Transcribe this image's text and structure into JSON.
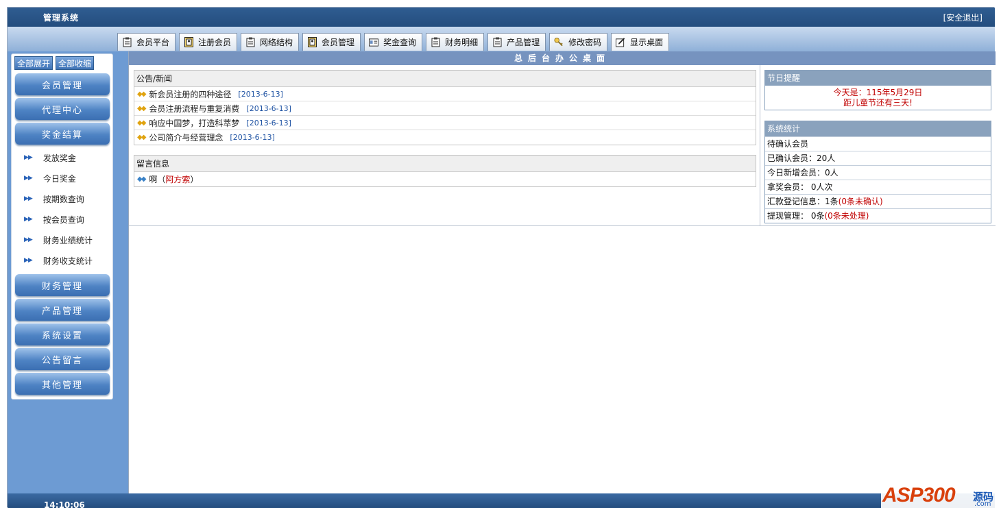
{
  "header": {
    "title": "管理系统",
    "logout": "[安全退出]"
  },
  "tabs": [
    {
      "label": "会员平台",
      "icon": "clipboard-icon"
    },
    {
      "label": "注册会员",
      "icon": "user-card-icon"
    },
    {
      "label": "网络结构",
      "icon": "clipboard-icon"
    },
    {
      "label": "会员管理",
      "icon": "user-card-icon"
    },
    {
      "label": "奖金查询",
      "icon": "id-card-icon"
    },
    {
      "label": "财务明细",
      "icon": "clipboard-icon"
    },
    {
      "label": "产品管理",
      "icon": "clipboard-icon"
    },
    {
      "label": "修改密码",
      "icon": "key-icon"
    },
    {
      "label": "显示桌面",
      "icon": "edit-icon"
    }
  ],
  "sidebar": {
    "expand_all": "全部展开",
    "collapse_all": "全部收缩",
    "menus": [
      "会员管理",
      "代理中心",
      "奖金结算",
      "财务管理",
      "产品管理",
      "系统设置",
      "公告留言",
      "其他管理"
    ],
    "bonus_items": [
      "发放奖金",
      "今日奖金",
      "按期数查询",
      "按会员查询",
      "财务业绩统计",
      "财务收支统计"
    ]
  },
  "desk": {
    "title": "总后台办公桌面"
  },
  "news": {
    "header": "公告/新闻",
    "items": [
      {
        "title": "新会员注册的四种途径",
        "date": "[2013-6-13]"
      },
      {
        "title": "会员注册流程与重复消费",
        "date": "[2013-6-13]"
      },
      {
        "title": "响应中国梦，打造科萃梦",
        "date": "[2013-6-13]"
      },
      {
        "title": "公司简介与经营理念",
        "date": "[2013-6-13]"
      }
    ]
  },
  "messages": {
    "header": "留言信息",
    "items": [
      {
        "text": "啊",
        "open": "（",
        "author": "阿方索",
        "close": "）"
      }
    ]
  },
  "holiday": {
    "header": "节日提醒",
    "line1": "今天是：115年5月29日",
    "line2": "距儿童节还有三天!"
  },
  "stats": {
    "header": "系统统计",
    "pending": "待确认会员",
    "confirmed": "已确认会员：20人",
    "new_today": "今日新增会员：0人",
    "bonus_members": "拿奖会员： 0人次",
    "remit_label": "汇款登记信息：1条",
    "remit_note": "(0条未确认)",
    "withdraw_label": "提现管理： 0条",
    "withdraw_note": "(0条未处理)"
  },
  "footer": {
    "time": "14:10:06"
  },
  "watermark": {
    "brand": "ASP300",
    "tag": "源码",
    "domain": ".com"
  },
  "colors": {
    "topbar": "#2f5d91",
    "sidebar": "#6d9bd3",
    "accent_red": "#c00000",
    "date_blue": "#1f53a3"
  }
}
